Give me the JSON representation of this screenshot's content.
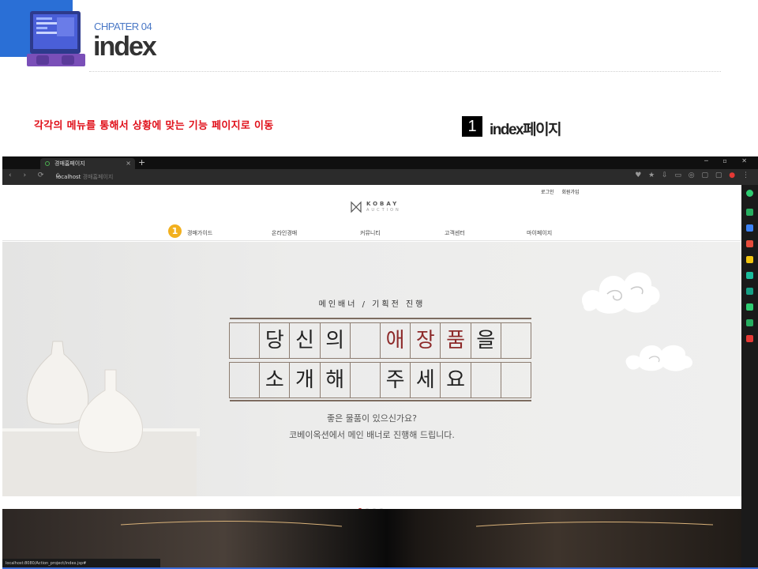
{
  "slide": {
    "chapter": "CHPATER 04",
    "title": "index",
    "description": "각각의 메뉴를 통해서 상황에 맞는 기능 페이지로 이동",
    "number": "1",
    "page_label": "index페이지"
  },
  "browser": {
    "tab_title": "경매홈페이지",
    "tab_close": "×",
    "new_tab": "+",
    "url_host": "localhost",
    "url_path": "경매홈페이지",
    "status_url": "localhost:8080/Action_project/index.jsp#"
  },
  "site": {
    "login": "로그인",
    "signup": "회원가입",
    "logo": "KOBAY",
    "logo_sub": "AUCTION",
    "menu_badge": "1",
    "menu": [
      "경매가이드",
      "온라인경매",
      "커뮤니티",
      "고객센터",
      "마이페이지"
    ],
    "banner": {
      "subtitle": "메인배너 / 기획전 진행",
      "row1": [
        "",
        "당",
        "신",
        "의",
        "",
        "애",
        "장",
        "품",
        "을",
        ""
      ],
      "row2": [
        "",
        "소",
        "개",
        "해",
        "",
        "주",
        "세",
        "요",
        "",
        ""
      ],
      "desc1": "좋은 물품이 있으신가요?",
      "desc2": "코베이옥션에서 메인 배너로 진행해 드립니다."
    },
    "slider_dots": 4,
    "active_dot": 0
  },
  "colors": {
    "accent_red": "#e0101a",
    "chapter_blue": "#4a78c6",
    "badge_yellow": "#f2b01e"
  }
}
